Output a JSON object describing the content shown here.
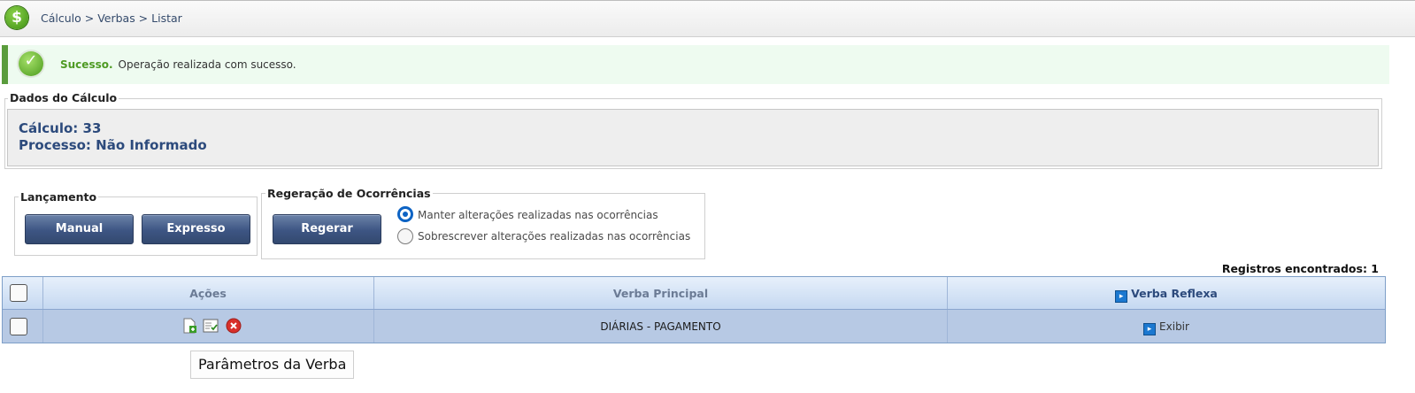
{
  "breadcrumb": "Cálculo > Verbas > Listar",
  "alert": {
    "title": "Sucesso.",
    "message": "Operação realizada com sucesso."
  },
  "calc": {
    "legend": "Dados do Cálculo",
    "calculo": "Cálculo: 33",
    "processo": "Processo: Não Informado"
  },
  "lancamento": {
    "legend": "Lançamento",
    "manual": "Manual",
    "expresso": "Expresso"
  },
  "regeracao": {
    "legend": "Regeração de Ocorrências",
    "button": "Regerar",
    "options": [
      "Manter alterações realizadas nas ocorrências",
      "Sobrescrever alterações realizadas nas ocorrências"
    ],
    "selected": 0
  },
  "records": "Registros encontrados: 1",
  "table": {
    "headers": {
      "acoes": "Ações",
      "verba_principal": "Verba Principal",
      "verba_reflexa": "Verba Reflexa"
    },
    "rows": [
      {
        "verba_principal": "DIÁRIAS - PAGAMENTO",
        "verba_reflexa": "Exibir"
      }
    ]
  },
  "tooltip": "Parâmetros da Verba",
  "colors": {
    "button": "#3d5583",
    "success_border": "#5a9c3c",
    "header_text": "#2c4a7c",
    "row_bg": "#b7c9e4"
  }
}
